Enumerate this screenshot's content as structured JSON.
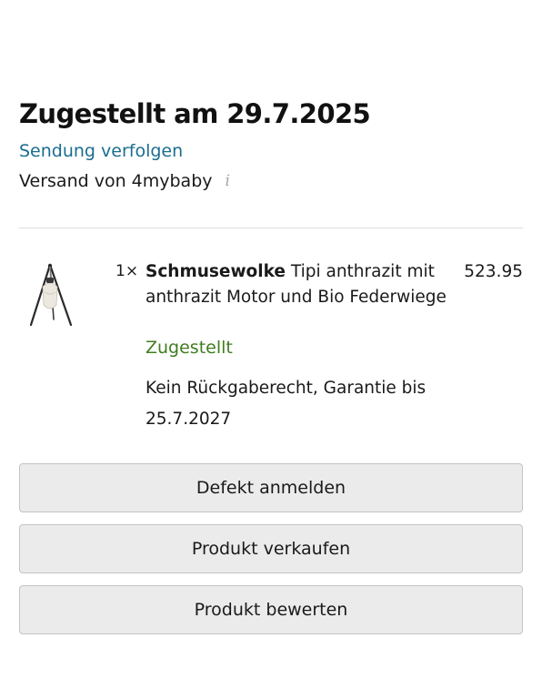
{
  "delivery": {
    "title": "Zugestellt am 29.7.2025",
    "tracking_link": "Sendung verfolgen",
    "shipped_by": "Versand von 4mybaby",
    "info_icon": "i"
  },
  "item": {
    "quantity": "1×",
    "brand": "Schmusewolke",
    "name_rest": " Tipi anthrazit mit anthrazit Motor und Bio Federwiege",
    "price": "523.95",
    "status": "Zugestellt",
    "status_color": "#3f7d1f",
    "return_info": "Kein Rückgaberecht, Garantie bis 25.7.2027",
    "image_icon": "tipi-baby-swing-image"
  },
  "actions": {
    "report_defect": "Defekt anmelden",
    "sell_product": "Produkt verkaufen",
    "rate_product": "Produkt bewerten"
  },
  "colors": {
    "link": "#1b6d8f",
    "button_bg": "#ebebeb",
    "button_border": "#c4c4c4",
    "divider": "#dedede"
  }
}
